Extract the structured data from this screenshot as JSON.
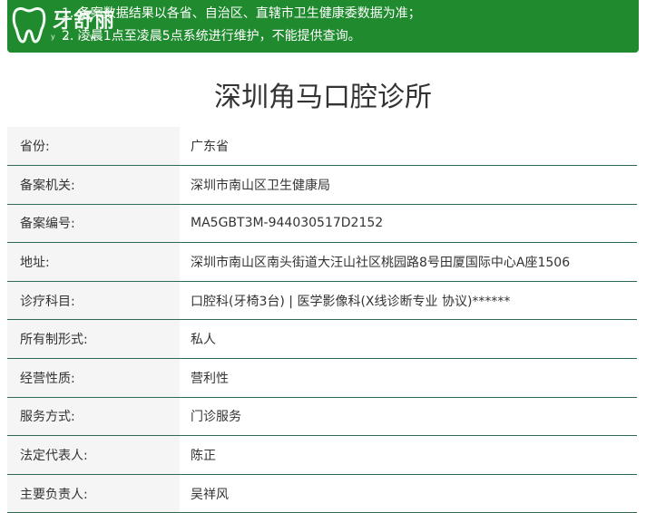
{
  "notice": {
    "logo_text": "牙舒丽",
    "logo_sub": "y s l w",
    "line1": "1. 备案数据结果以各省、自治区、直辖市卫生健康委数据为准；",
    "line2": "2. 凌晨1点至凌晨5点系统进行维护，不能提供查询。"
  },
  "page_title": "深圳角马口腔诊所",
  "rows": [
    {
      "label": "省份:",
      "value": "广东省"
    },
    {
      "label": "备案机关:",
      "value": "深圳市南山区卫生健康局"
    },
    {
      "label": "备案编号:",
      "value": "MA5GBT3M-944030517D2152"
    },
    {
      "label": "地址:",
      "value": "深圳市南山区南头街道大汪山社区桃园路8号田厦国际中心A座1506"
    },
    {
      "label": "诊疗科目:",
      "value": "口腔科(牙椅3台) | 医学影像科(X线诊断专业 协议)******"
    },
    {
      "label": "所有制形式:",
      "value": "私人"
    },
    {
      "label": "经营性质:",
      "value": "营利性"
    },
    {
      "label": "服务方式:",
      "value": "门诊服务"
    },
    {
      "label": "法定代表人:",
      "value": "陈正"
    },
    {
      "label": "主要负责人:",
      "value": "吴祥风"
    }
  ],
  "colors": {
    "banner": "#1f8a2e",
    "row_border": "#2f6a52",
    "label_bg": "#f5f5f5"
  }
}
